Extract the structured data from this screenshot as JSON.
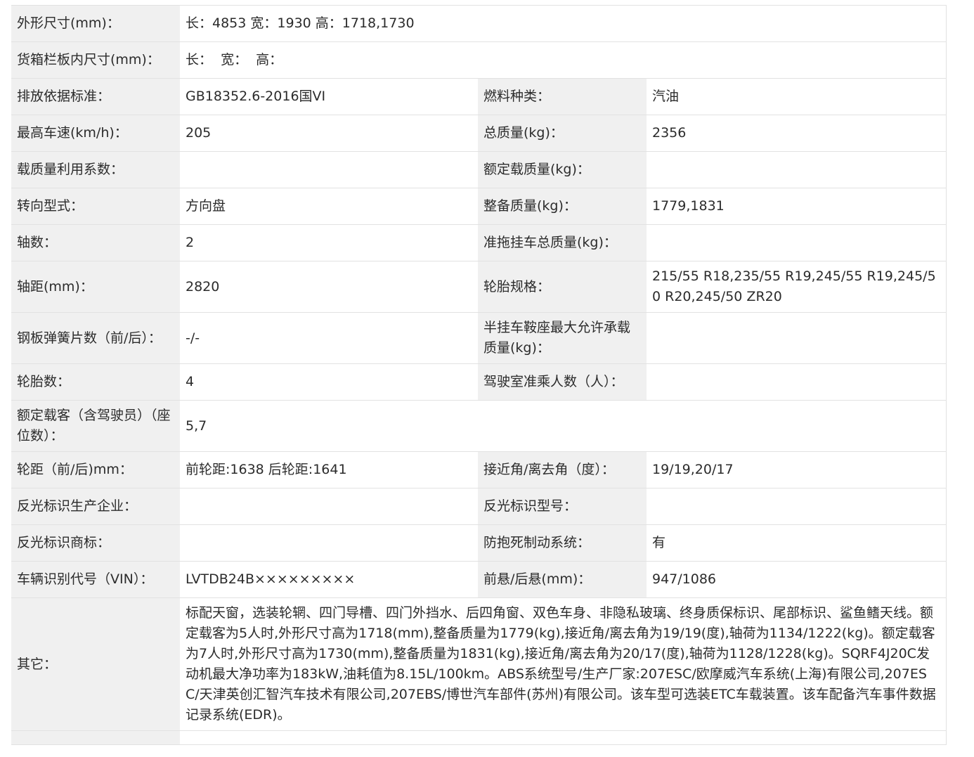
{
  "rows": {
    "dimensions": {
      "label": "外形尺寸(mm)：",
      "value": "长：4853 宽：1930 高：1718,1730"
    },
    "cargo_box": {
      "label": "货箱栏板内尺寸(mm)：",
      "value": "长：  宽：  高："
    },
    "emission_standard": {
      "label": "排放依据标准：",
      "value": "GB18352.6-2016国VI"
    },
    "fuel_type": {
      "label": "燃料种类：",
      "value": "汽油"
    },
    "max_speed": {
      "label": "最高车速(km/h)：",
      "value": "205"
    },
    "total_mass": {
      "label": "总质量(kg)：",
      "value": "2356"
    },
    "load_utilization": {
      "label": "载质量利用系数：",
      "value": ""
    },
    "rated_load": {
      "label": "额定载质量(kg)：",
      "value": ""
    },
    "steering": {
      "label": "转向型式：",
      "value": "方向盘"
    },
    "curb_mass": {
      "label": "整备质量(kg)：",
      "value": "1779,1831"
    },
    "axles": {
      "label": "轴数：",
      "value": "2"
    },
    "trailer_mass": {
      "label": "准拖挂车总质量(kg)：",
      "value": ""
    },
    "wheelbase": {
      "label": "轴距(mm)：",
      "value": "2820"
    },
    "tire_spec": {
      "label": "轮胎规格：",
      "value": "215/55 R18,235/55 R19,245/55 R19,245/50 R20,245/50 ZR20"
    },
    "leaf_springs": {
      "label": "钢板弹簧片数（前/后）：",
      "value": "-/-"
    },
    "saddle_load": {
      "label": "半挂车鞍座最大允许承载质量(kg)：",
      "value": ""
    },
    "tire_count": {
      "label": "轮胎数：",
      "value": "4"
    },
    "cab_passengers": {
      "label": "驾驶室准乘人数（人）：",
      "value": ""
    },
    "rated_passengers": {
      "label": "额定载客（含驾驶员）（座位数）：",
      "value": "5,7"
    },
    "track": {
      "label": "轮距（前/后)mm：",
      "value": "前轮距:1638 后轮距:1641"
    },
    "approach_departure": {
      "label": "接近角/离去角（度）：",
      "value": "19/19,20/17"
    },
    "reflective_maker": {
      "label": "反光标识生产企业：",
      "value": ""
    },
    "reflective_model": {
      "label": "反光标识型号：",
      "value": ""
    },
    "reflective_brand": {
      "label": "反光标识商标：",
      "value": ""
    },
    "abs": {
      "label": "防抱死制动系统：",
      "value": "有"
    },
    "vin": {
      "label": "车辆识别代号（VIN）：",
      "value": "LVTDB24B×××××××××"
    },
    "overhang": {
      "label": "前悬/后悬(mm)：",
      "value": "947/1086"
    },
    "other": {
      "label": "其它：",
      "value": "标配天窗，选装轮辋、四门导槽、四门外挡水、后四角窗、双色车身、非隐私玻璃、终身质保标识、尾部标识、鲨鱼鳍天线。额定载客为5人时,外形尺寸高为1718(mm),整备质量为1779(kg),接近角/离去角为19/19(度),轴荷为1134/1222(kg)。额定载客为7人时,外形尺寸高为1730(mm),整备质量为1831(kg),接近角/离去角为20/17(度),轴荷为1128/1228(kg)。SQRF4J20C发动机最大净功率为183kW,油耗值为8.15L/100km。ABS系统型号/生产厂家:207ESC/欧摩威汽车系统(上海)有限公司,207ESC/天津英创汇智汽车技术有限公司,207EBS/博世汽车部件(苏州)有限公司。该车型可选装ETC车载装置。该车配备汽车事件数据记录系统(EDR)。"
    }
  }
}
